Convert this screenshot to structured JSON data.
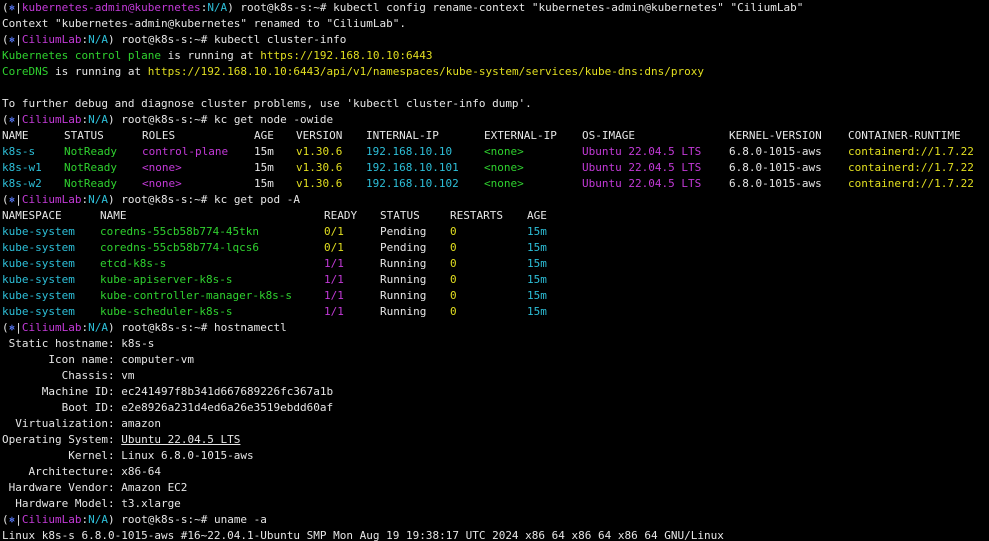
{
  "colors": {
    "fg": "#e6e6e6",
    "green": "#2fd12f",
    "yellow": "#e2df20",
    "magenta": "#c33ad8",
    "cyan": "#2dbfd8",
    "blue": "#5a7cff",
    "underline_fg": "#e6e6e6"
  },
  "lines": [
    [
      {
        "t": "(",
        "c": "fg"
      },
      {
        "t": "⎈",
        "c": "blue"
      },
      {
        "t": "|",
        "c": "fg"
      },
      {
        "t": "kubernetes-admin@kubernetes",
        "c": "magenta"
      },
      {
        "t": ":",
        "c": "fg"
      },
      {
        "t": "N/A",
        "c": "cyan"
      },
      {
        "t": ") root@k8s-s:~# kubectl config rename-context \"kubernetes-admin@kubernetes\" \"CiliumLab\"",
        "c": "fg"
      }
    ],
    [
      {
        "t": "Context \"kubernetes-admin@kubernetes\" renamed to \"CiliumLab\".",
        "c": "fg"
      }
    ],
    [
      {
        "t": "(",
        "c": "fg"
      },
      {
        "t": "⎈",
        "c": "blue"
      },
      {
        "t": "|",
        "c": "fg"
      },
      {
        "t": "CiliumLab",
        "c": "magenta"
      },
      {
        "t": ":",
        "c": "fg"
      },
      {
        "t": "N/A",
        "c": "cyan"
      },
      {
        "t": ") root@k8s-s:~# kubectl cluster-info",
        "c": "fg"
      }
    ],
    [
      {
        "t": "Kubernetes control plane",
        "c": "green"
      },
      {
        "t": " is running at ",
        "c": "fg"
      },
      {
        "t": "https://192.168.10.10:6443",
        "c": "yellow"
      }
    ],
    [
      {
        "t": "CoreDNS",
        "c": "green"
      },
      {
        "t": " is running at ",
        "c": "fg"
      },
      {
        "t": "https://192.168.10.10:6443/api/v1/namespaces/kube-system/services/kube-dns:dns/proxy",
        "c": "yellow"
      }
    ],
    [],
    [
      {
        "t": "To further debug and diagnose cluster problems, use 'kubectl cluster-info dump'.",
        "c": "fg"
      }
    ],
    [
      {
        "t": "(",
        "c": "fg"
      },
      {
        "t": "⎈",
        "c": "blue"
      },
      {
        "t": "|",
        "c": "fg"
      },
      {
        "t": "CiliumLab",
        "c": "magenta"
      },
      {
        "t": ":",
        "c": "fg"
      },
      {
        "t": "N/A",
        "c": "cyan"
      },
      {
        "t": ") root@k8s-s:~# kc get node -owide",
        "c": "fg"
      }
    ],
    {
      "table": "node_header"
    },
    {
      "table": "node_row_0"
    },
    {
      "table": "node_row_1"
    },
    {
      "table": "node_row_2"
    },
    [
      {
        "t": "(",
        "c": "fg"
      },
      {
        "t": "⎈",
        "c": "blue"
      },
      {
        "t": "|",
        "c": "fg"
      },
      {
        "t": "CiliumLab",
        "c": "magenta"
      },
      {
        "t": ":",
        "c": "fg"
      },
      {
        "t": "N/A",
        "c": "cyan"
      },
      {
        "t": ") root@k8s-s:~# kc get pod -A",
        "c": "fg"
      }
    ],
    {
      "table": "pod_header"
    },
    {
      "table": "pod_row_0"
    },
    {
      "table": "pod_row_1"
    },
    {
      "table": "pod_row_2"
    },
    {
      "table": "pod_row_3"
    },
    {
      "table": "pod_row_4"
    },
    {
      "table": "pod_row_5"
    },
    [
      {
        "t": "(",
        "c": "fg"
      },
      {
        "t": "⎈",
        "c": "blue"
      },
      {
        "t": "|",
        "c": "fg"
      },
      {
        "t": "CiliumLab",
        "c": "magenta"
      },
      {
        "t": ":",
        "c": "fg"
      },
      {
        "t": "N/A",
        "c": "cyan"
      },
      {
        "t": ") root@k8s-s:~# hostnamectl",
        "c": "fg"
      }
    ],
    [
      {
        "t": " Static hostname: k8s-s",
        "c": "fg"
      }
    ],
    [
      {
        "t": "       Icon name: computer-vm",
        "c": "fg"
      }
    ],
    [
      {
        "t": "         Chassis: vm",
        "c": "fg"
      }
    ],
    [
      {
        "t": "      Machine ID: ec241497f8b341d667689226fc367a1b",
        "c": "fg"
      }
    ],
    [
      {
        "t": "         Boot ID: e2e8926a231d4ed6a26e3519ebdd60af",
        "c": "fg"
      }
    ],
    [
      {
        "t": "  Virtualization: amazon",
        "c": "fg"
      }
    ],
    [
      {
        "t": "Operating System: ",
        "c": "fg"
      },
      {
        "t": "Ubuntu 22.04.5 LTS",
        "c": "fg",
        "u": true
      }
    ],
    [
      {
        "t": "          Kernel: Linux 6.8.0-1015-aws",
        "c": "fg"
      }
    ],
    [
      {
        "t": "    Architecture: x86-64",
        "c": "fg"
      }
    ],
    [
      {
        "t": " Hardware Vendor: Amazon EC2",
        "c": "fg"
      }
    ],
    [
      {
        "t": "  Hardware Model: t3.xlarge",
        "c": "fg"
      }
    ],
    [
      {
        "t": "(",
        "c": "fg"
      },
      {
        "t": "⎈",
        "c": "blue"
      },
      {
        "t": "|",
        "c": "fg"
      },
      {
        "t": "CiliumLab",
        "c": "magenta"
      },
      {
        "t": ":",
        "c": "fg"
      },
      {
        "t": "N/A",
        "c": "cyan"
      },
      {
        "t": ") root@k8s-s:~# uname -a",
        "c": "fg"
      }
    ],
    [
      {
        "t": "Linux k8s-s 6.8.0-1015-aws #16~22.04.1-Ubuntu SMP Mon Aug 19 19:38:17 UTC 2024 x86_64 x86_64 x86_64 GNU/Linux",
        "c": "fg"
      }
    ]
  ],
  "node_table": {
    "header": [
      "NAME",
      "STATUS",
      "ROLES",
      "AGE",
      "VERSION",
      "INTERNAL-IP",
      "EXTERNAL-IP",
      "OS-IMAGE",
      "KERNEL-VERSION",
      "CONTAINER-RUNTIME"
    ],
    "rows": [
      [
        "k8s-s",
        "NotReady",
        "control-plane",
        "15m",
        "v1.30.6",
        "192.168.10.10",
        "<none>",
        "Ubuntu 22.04.5 LTS",
        "6.8.0-1015-aws",
        "containerd://1.7.22"
      ],
      [
        "k8s-w1",
        "NotReady",
        "<none>",
        "15m",
        "v1.30.6",
        "192.168.10.101",
        "<none>",
        "Ubuntu 22.04.5 LTS",
        "6.8.0-1015-aws",
        "containerd://1.7.22"
      ],
      [
        "k8s-w2",
        "NotReady",
        "<none>",
        "15m",
        "v1.30.6",
        "192.168.10.102",
        "<none>",
        "Ubuntu 22.04.5 LTS",
        "6.8.0-1015-aws",
        "containerd://1.7.22"
      ]
    ],
    "col_colors": [
      "cyan",
      "green",
      "magenta",
      "fg",
      "yellow",
      "cyan",
      "green",
      "magenta",
      "fg",
      "yellow"
    ]
  },
  "pod_table": {
    "header": [
      "NAMESPACE",
      "NAME",
      "READY",
      "STATUS",
      "RESTARTS",
      "AGE"
    ],
    "rows": [
      [
        "kube-system",
        "coredns-55cb58b774-45tkn",
        "0/1",
        "Pending",
        "0",
        "15m"
      ],
      [
        "kube-system",
        "coredns-55cb58b774-lqcs6",
        "0/1",
        "Pending",
        "0",
        "15m"
      ],
      [
        "kube-system",
        "etcd-k8s-s",
        "1/1",
        "Running",
        "0",
        "15m"
      ],
      [
        "kube-system",
        "kube-apiserver-k8s-s",
        "1/1",
        "Running",
        "0",
        "15m"
      ],
      [
        "kube-system",
        "kube-controller-manager-k8s-s",
        "1/1",
        "Running",
        "0",
        "15m"
      ],
      [
        "kube-system",
        "kube-scheduler-k8s-s",
        "1/1",
        "Running",
        "0",
        "15m"
      ]
    ],
    "row_colors": [
      [
        "cyan",
        "green",
        "yellow",
        "fg",
        "yellow",
        "cyan"
      ],
      [
        "cyan",
        "green",
        "yellow",
        "fg",
        "yellow",
        "cyan"
      ],
      [
        "cyan",
        "green",
        "magenta",
        "fg",
        "yellow",
        "cyan"
      ],
      [
        "cyan",
        "green",
        "magenta",
        "fg",
        "yellow",
        "cyan"
      ],
      [
        "cyan",
        "green",
        "magenta",
        "fg",
        "yellow",
        "cyan"
      ],
      [
        "cyan",
        "green",
        "magenta",
        "fg",
        "yellow",
        "cyan"
      ]
    ]
  }
}
